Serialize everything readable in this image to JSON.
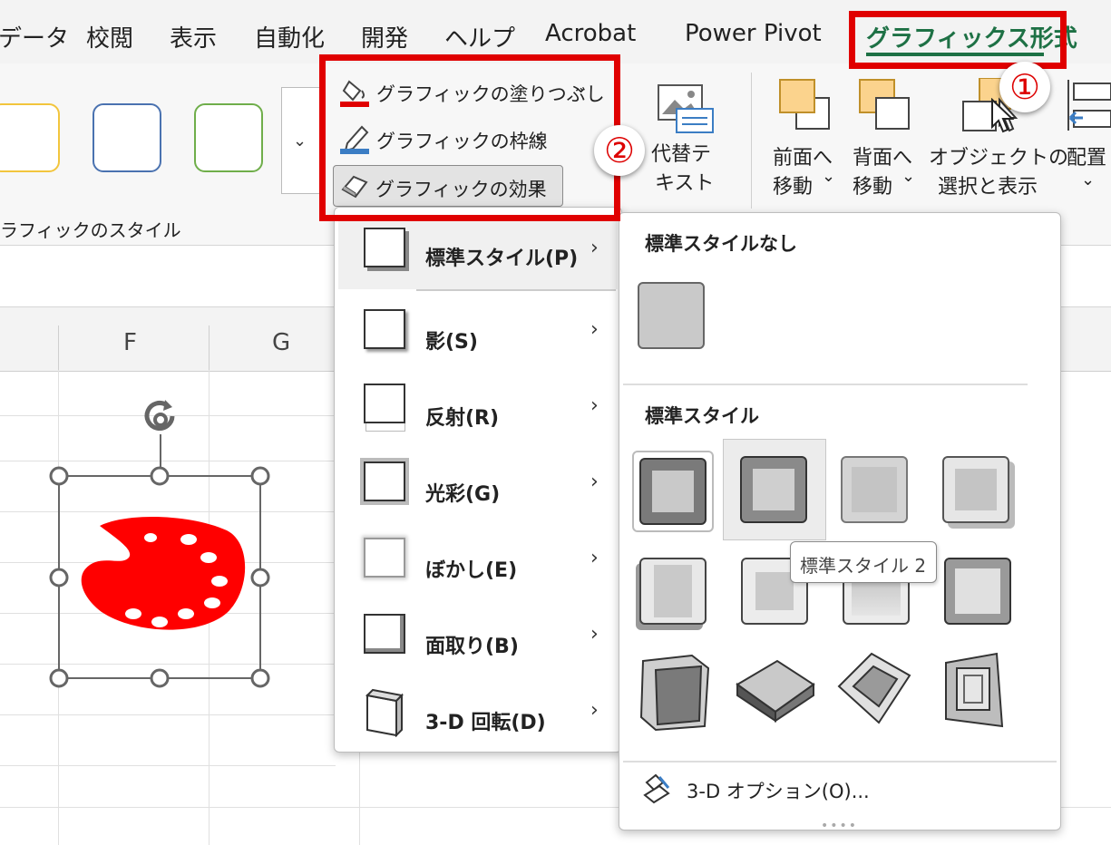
{
  "tabs": [
    "データ",
    "校閲",
    "表示",
    "自動化",
    "開発",
    "ヘルプ",
    "Acrobat",
    "Power Pivot",
    "グラフィックス形式"
  ],
  "ribbon": {
    "style_group_label": "ラフィックのスタイル",
    "fill_label": "グラフィックの塗りつぶし",
    "outline_label": "グラフィックの枠線",
    "effects_label": "グラフィックの効果",
    "alt_text_line1": "代替テ",
    "alt_text_line2": "キスト",
    "bring_forward_line1": "前面へ",
    "bring_forward_line2": "移動",
    "send_backward_line1": "背面へ",
    "send_backward_line2": "移動",
    "selection_pane_line1": "オブジェクトの",
    "selection_pane_line2": "選択と表示",
    "align_label": "配置",
    "style_colors": [
      "#f2c53d",
      "#4a72b0",
      "#6fae4a"
    ]
  },
  "columns": [
    "F",
    "G"
  ],
  "effects_menu": {
    "items": [
      {
        "label": "標準スタイル(P)",
        "name": "preset"
      },
      {
        "label": "影(S)",
        "name": "shadow"
      },
      {
        "label": "反射(R)",
        "name": "reflection"
      },
      {
        "label": "光彩(G)",
        "name": "glow"
      },
      {
        "label": "ぼかし(E)",
        "name": "soft-edges"
      },
      {
        "label": "面取り(B)",
        "name": "bevel"
      },
      {
        "label": "3-D 回転(D)",
        "name": "3d-rotation"
      }
    ]
  },
  "preset_panel": {
    "none_header": "標準スタイルなし",
    "presets_header": "標準スタイル",
    "tooltip": "標準スタイル 2",
    "options_label": "3-D オプション(O)..."
  },
  "badges": {
    "one": "①",
    "two": "②"
  },
  "accent": {
    "highlight_red": "#e00000",
    "tab_green": "#1e7145",
    "shape_red": "#ff0000"
  }
}
